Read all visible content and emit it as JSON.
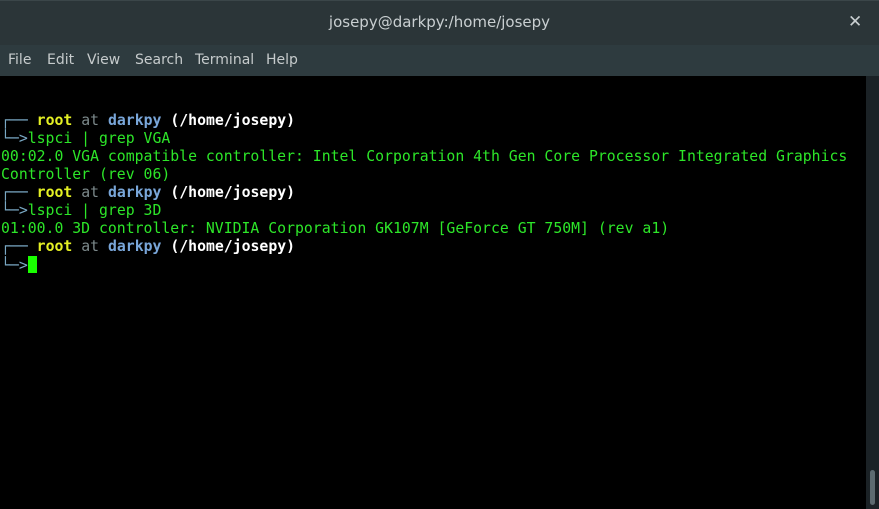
{
  "window": {
    "title": "josepy@darkpy:/home/josepy",
    "close_symbol": "✕"
  },
  "menu": [
    "File",
    "Edit",
    "View",
    "Search",
    "Terminal",
    "Help"
  ],
  "terminal": {
    "prompts": [
      {
        "user": "root",
        "at": "at",
        "host": "darkpy",
        "path": "(/home/josepy)",
        "command": "lspci | grep VGA"
      },
      {
        "user": "root",
        "at": "at",
        "host": "darkpy",
        "path": "(/home/josepy)",
        "command": "lspci | grep 3D"
      },
      {
        "user": "root",
        "at": "at",
        "host": "darkpy",
        "path": "(/home/josepy)",
        "command": ""
      }
    ],
    "prompt_top_glyph": "┌──",
    "prompt_bottom_glyph": "└─>",
    "output": [
      "00:02.0 VGA compatible controller: Intel Corporation 4th Gen Core Processor Integrated Graphics",
      "Controller (rev 06)",
      "01:00.0 3D controller: NVIDIA Corporation GK107M [GeForce GT 750M] (rev a1)"
    ]
  },
  "colors": {
    "titlebar": "#2b3538",
    "menubar": "#2e3b3f",
    "terminal_bg": "#000000",
    "prompt_user": "#e4f024",
    "prompt_host": "#79a6d9",
    "output_green": "#2de629",
    "cursor": "#19ff00"
  }
}
